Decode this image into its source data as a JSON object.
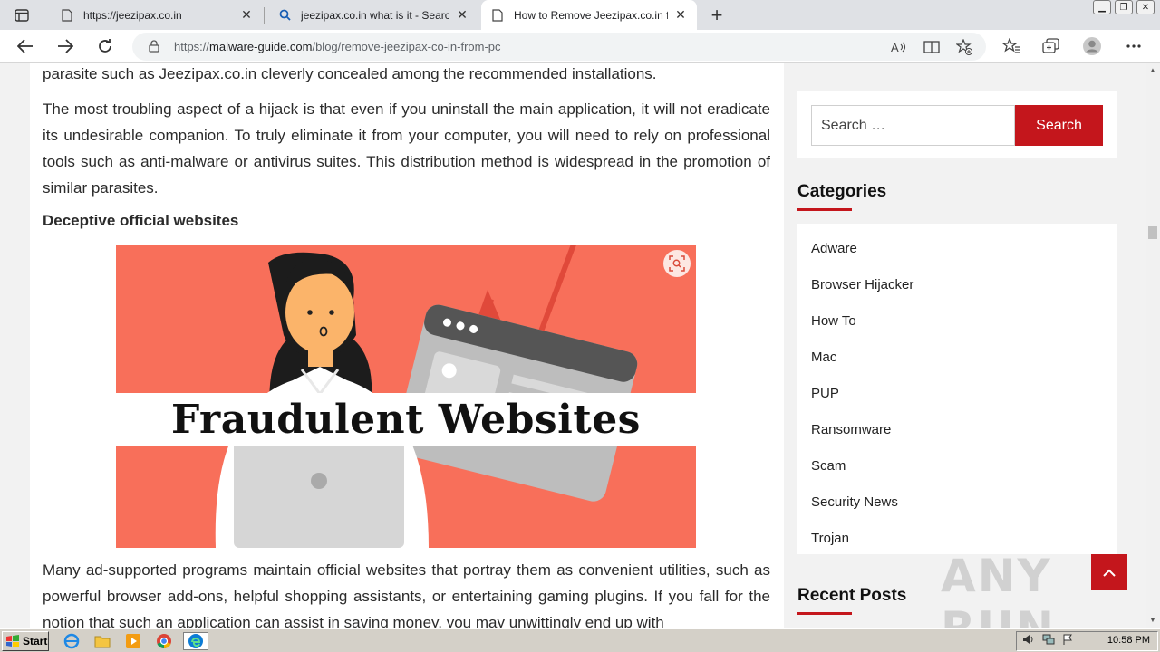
{
  "browser": {
    "tabs": [
      {
        "title": "https://jeezipax.co.in",
        "active": false,
        "icon": "page-icon"
      },
      {
        "title": "jeezipax.co.in what is it - Search",
        "active": false,
        "icon": "search-icon"
      },
      {
        "title": "How to Remove Jeezipax.co.in f",
        "active": true,
        "icon": "page-icon"
      }
    ],
    "url_prefix": "https://",
    "url_host": "malware-guide.com",
    "url_path": "/blog/remove-jeezipax-co-in-from-pc"
  },
  "article": {
    "para_top": "parasite such as Jeezipax.co.in cleverly concealed among the recommended installations.",
    "para_hijack": "The most troubling aspect of a hijack is that even if you uninstall the main application, it will not eradicate its undesirable companion. To truly eliminate it from your computer, you will need to rely on professional tools such as anti-malware or antivirus suites. This distribution method is widespread in the promotion of similar parasites.",
    "heading": "Deceptive official websites",
    "image_caption": "Fraudulent Websites",
    "para_bottom": "Many ad-supported programs maintain official websites that portray them as convenient utilities, such as powerful browser add-ons, helpful shopping assistants, or entertaining gaming plugins. If you fall for the notion that such an application can assist in saving money, you may unwittingly end up with"
  },
  "sidebar": {
    "search_placeholder": "Search …",
    "search_button": "Search",
    "categories_title": "Categories",
    "categories": [
      "Adware",
      "Browser Hijacker",
      "How To",
      "Mac",
      "PUP",
      "Ransomware",
      "Scam",
      "Security News",
      "Trojan"
    ],
    "recent_title": "Recent Posts"
  },
  "watermark": "ANY RUN",
  "taskbar": {
    "start_label": "Start",
    "clock": "10:58 PM"
  },
  "colors": {
    "accent": "#c4161c",
    "image_bg": "#f86f5a"
  }
}
